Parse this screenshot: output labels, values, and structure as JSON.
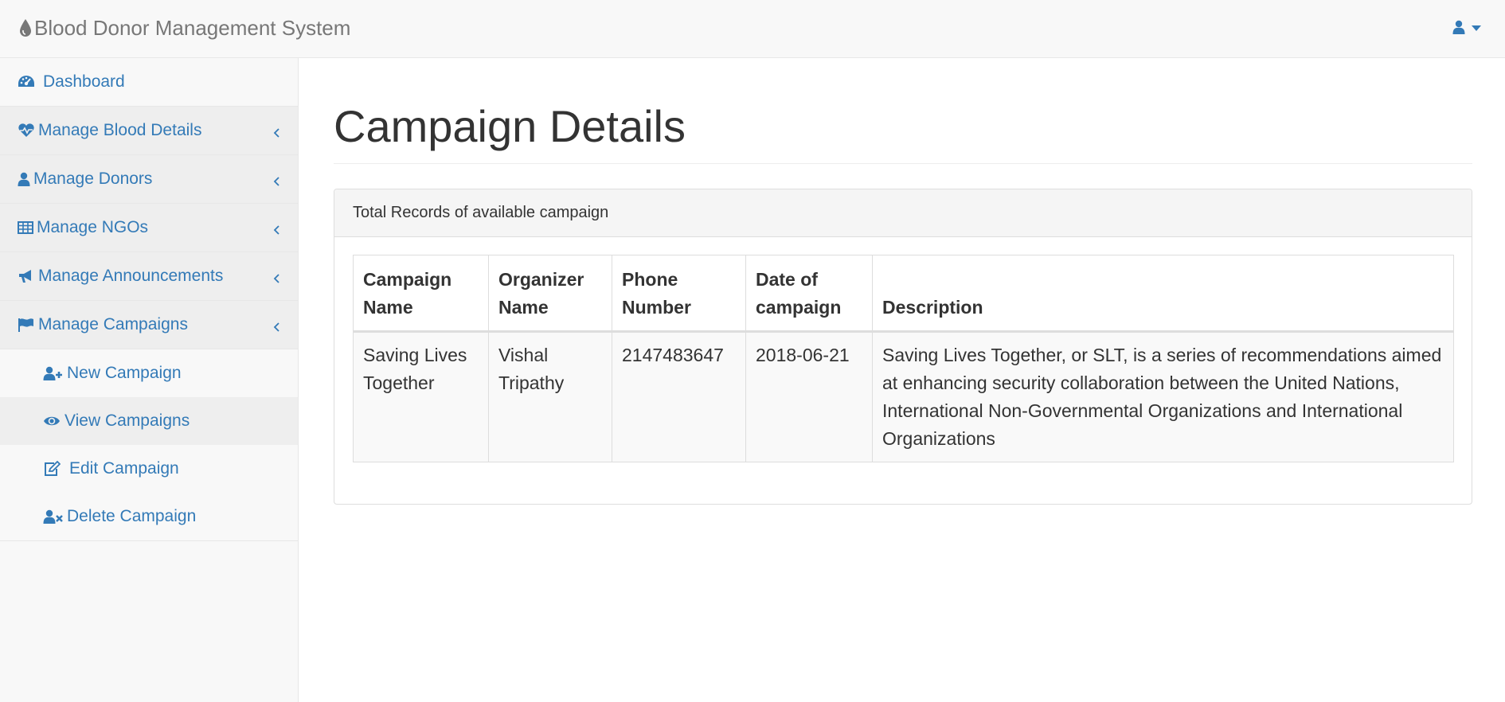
{
  "navbar": {
    "brand": "Blood Donor Management System",
    "brand_icon": "blood-drop-icon",
    "user_icon": "user-icon",
    "caret_icon": "caret-down-icon"
  },
  "sidebar": {
    "dashboard": {
      "label": "Dashboard",
      "icon": "dashboard-icon"
    },
    "groups": [
      {
        "label": "Manage Blood Details",
        "icon": "heartbeat-icon"
      },
      {
        "label": "Manage Donors",
        "icon": "user-icon"
      },
      {
        "label": "Manage NGOs",
        "icon": "table-icon"
      },
      {
        "label": "Manage Announcements",
        "icon": "bullhorn-icon"
      },
      {
        "label": "Manage Campaigns",
        "icon": "flag-icon"
      }
    ],
    "campaign_items": [
      {
        "label": "New Campaign",
        "icon": "user-plus-icon"
      },
      {
        "label": "View Campaigns",
        "icon": "eye-icon",
        "active": true
      },
      {
        "label": "Edit Campaign",
        "icon": "edit-icon"
      },
      {
        "label": "Delete Campaign",
        "icon": "user-times-icon"
      }
    ]
  },
  "main": {
    "title": "Campaign Details",
    "panel_heading": "Total Records of available campaign",
    "table": {
      "headers": [
        "Campaign Name",
        "Organizer Name",
        "Phone Number",
        "Date of campaign",
        "Description"
      ],
      "rows": [
        [
          "Saving Lives Together",
          "Vishal Tripathy",
          "2147483647",
          "2018-06-21",
          "Saving Lives Together, or SLT, is a series of recommendations aimed at enhancing security collaboration between the United Nations, International Non-Governmental Organizations and International Organizations"
        ]
      ]
    }
  },
  "colors": {
    "link": "#337ab7",
    "brand_text": "#777777",
    "sidebar_bg": "#f8f8f8",
    "sidebar_group_bg": "#eeeeee"
  }
}
